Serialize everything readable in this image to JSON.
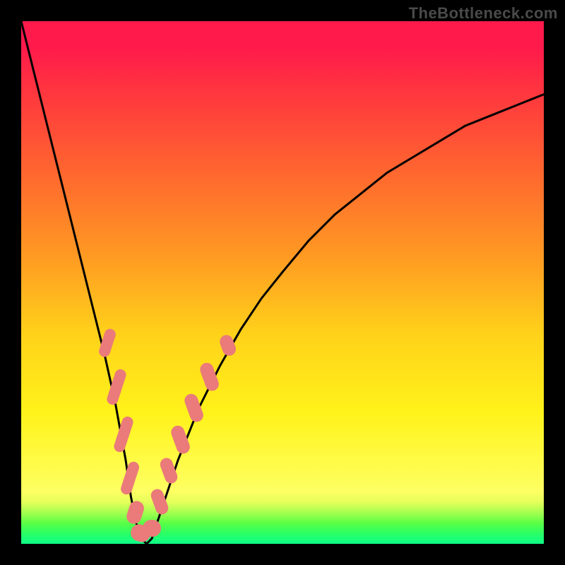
{
  "watermark": "TheBottleneck.com",
  "chart_data": {
    "type": "line",
    "title": "",
    "xlabel": "",
    "ylabel": "",
    "xlim": [
      0,
      100
    ],
    "ylim": [
      0,
      100
    ],
    "series": [
      {
        "name": "curve",
        "x": [
          0,
          2,
          4,
          6,
          8,
          10,
          12,
          14,
          16,
          18,
          20,
          21,
          22,
          23,
          24,
          25,
          27,
          30,
          34,
          38,
          42,
          46,
          50,
          55,
          60,
          65,
          70,
          75,
          80,
          85,
          90,
          95,
          100
        ],
        "y": [
          100,
          92,
          84,
          76,
          68,
          60,
          52,
          44,
          36,
          27,
          16,
          9,
          4,
          1,
          0,
          1,
          7,
          16,
          26,
          34,
          41,
          47,
          52,
          58,
          63,
          67,
          71,
          74,
          77,
          80,
          82,
          84,
          86
        ]
      }
    ],
    "markers": [
      {
        "x": 16.5,
        "y": 38.5,
        "w": 2.2,
        "h": 5.5
      },
      {
        "x": 18.2,
        "y": 30.0,
        "w": 2.2,
        "h": 7.0
      },
      {
        "x": 19.6,
        "y": 21.0,
        "w": 2.2,
        "h": 7.0
      },
      {
        "x": 20.8,
        "y": 12.5,
        "w": 2.2,
        "h": 6.5
      },
      {
        "x": 21.8,
        "y": 6.0,
        "w": 2.8,
        "h": 4.5
      },
      {
        "x": 22.8,
        "y": 2.0,
        "w": 3.8,
        "h": 3.2
      },
      {
        "x": 25.0,
        "y": 3.0,
        "w": 3.6,
        "h": 3.2
      },
      {
        "x": 26.5,
        "y": 8.0,
        "w": 2.4,
        "h": 5.0
      },
      {
        "x": 28.2,
        "y": 14.0,
        "w": 2.4,
        "h": 5.0
      },
      {
        "x": 30.5,
        "y": 20.0,
        "w": 2.6,
        "h": 5.5
      },
      {
        "x": 33.0,
        "y": 26.0,
        "w": 2.6,
        "h": 5.5
      },
      {
        "x": 36.0,
        "y": 32.0,
        "w": 2.6,
        "h": 5.5
      },
      {
        "x": 39.5,
        "y": 38.0,
        "w": 2.6,
        "h": 4.0
      }
    ],
    "gradient_stops": [
      {
        "pct": 0,
        "color": "#ff1a4b"
      },
      {
        "pct": 30,
        "color": "#ff6a2e"
      },
      {
        "pct": 60,
        "color": "#ffd21a"
      },
      {
        "pct": 90,
        "color": "#fdff63"
      },
      {
        "pct": 100,
        "color": "#0eff88"
      }
    ]
  }
}
